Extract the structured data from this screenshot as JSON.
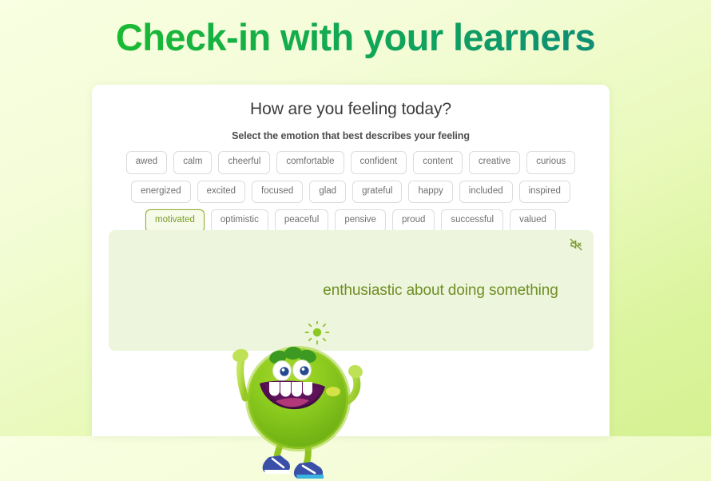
{
  "page": {
    "title": "Check-in with your learners",
    "title_gradient_from": "#1fc31f",
    "title_gradient_to": "#128b7e",
    "background_from": "#f8ffe2",
    "background_to": "#d5f292"
  },
  "card": {
    "heading": "How are you feeling today?",
    "subheading": "Select the emotion that best describes your feeling"
  },
  "emotions": {
    "selected": "motivated",
    "selected_border_color": "#8fae32",
    "selected_text_color": "#7a9a27",
    "selected_background_color": "#f6fbe9",
    "chip_text_color": "#6f6f6f",
    "chip_border_color": "#dcdcdc",
    "options": [
      "awed",
      "calm",
      "cheerful",
      "comfortable",
      "confident",
      "content",
      "creative",
      "curious",
      "energized",
      "excited",
      "focused",
      "glad",
      "grateful",
      "happy",
      "included",
      "inspired",
      "motivated",
      "optimistic",
      "peaceful",
      "pensive",
      "proud",
      "successful",
      "valued"
    ]
  },
  "definition_panel": {
    "text": "enthusiastic about doing something",
    "text_color": "#6e8f25",
    "background_color": "#edf5dc",
    "mute_icon": "speaker-muted-icon",
    "mascot_icon": "green-monster-mascot",
    "sun_icon": "sun-doodle-icon"
  }
}
